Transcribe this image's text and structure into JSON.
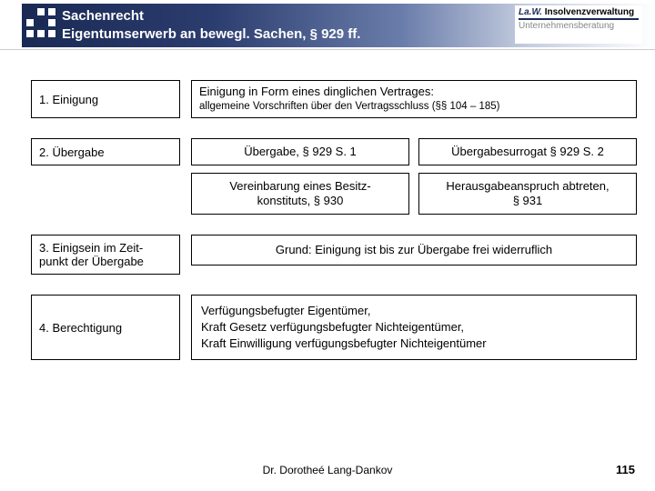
{
  "header": {
    "title_line1": "Sachenrecht",
    "title_line2": "Eigentumserwerb an bewegl. Sachen, § 929 ff."
  },
  "logo": {
    "brand": "La.W.",
    "word1": "Insolvenzverwaltung",
    "word2": "Unternehmensberatung"
  },
  "rows": {
    "r1": {
      "label": "1. Einigung",
      "main": "Einigung in Form eines dinglichen Vertrages:",
      "sub": "allgemeine Vorschriften über den Vertragsschluss (§§ 104 – 185)"
    },
    "r2": {
      "label": "2. Übergabe",
      "a": "Übergabe, § 929 S. 1",
      "b": "Übergabesurrogat § 929 S. 2",
      "c": "Vereinbarung eines Besitz-\nkonstituts, § 930",
      "d": "Herausgabeanspruch abtreten,\n§ 931"
    },
    "r3": {
      "label": "3. Einigsein im Zeit-\npunkt der Übergabe",
      "text": "Grund: Einigung ist bis zur Übergabe frei widerruflich"
    },
    "r4": {
      "label": "4. Berechtigung",
      "text": "Verfügungsbefugter Eigentümer,\nKraft Gesetz verfügungsbefugter Nichteigentümer,\nKraft Einwilligung verfügungsbefugter Nichteigentümer"
    }
  },
  "footer": {
    "author": "Dr. Dorotheé Lang-Dankov",
    "page": "115"
  }
}
